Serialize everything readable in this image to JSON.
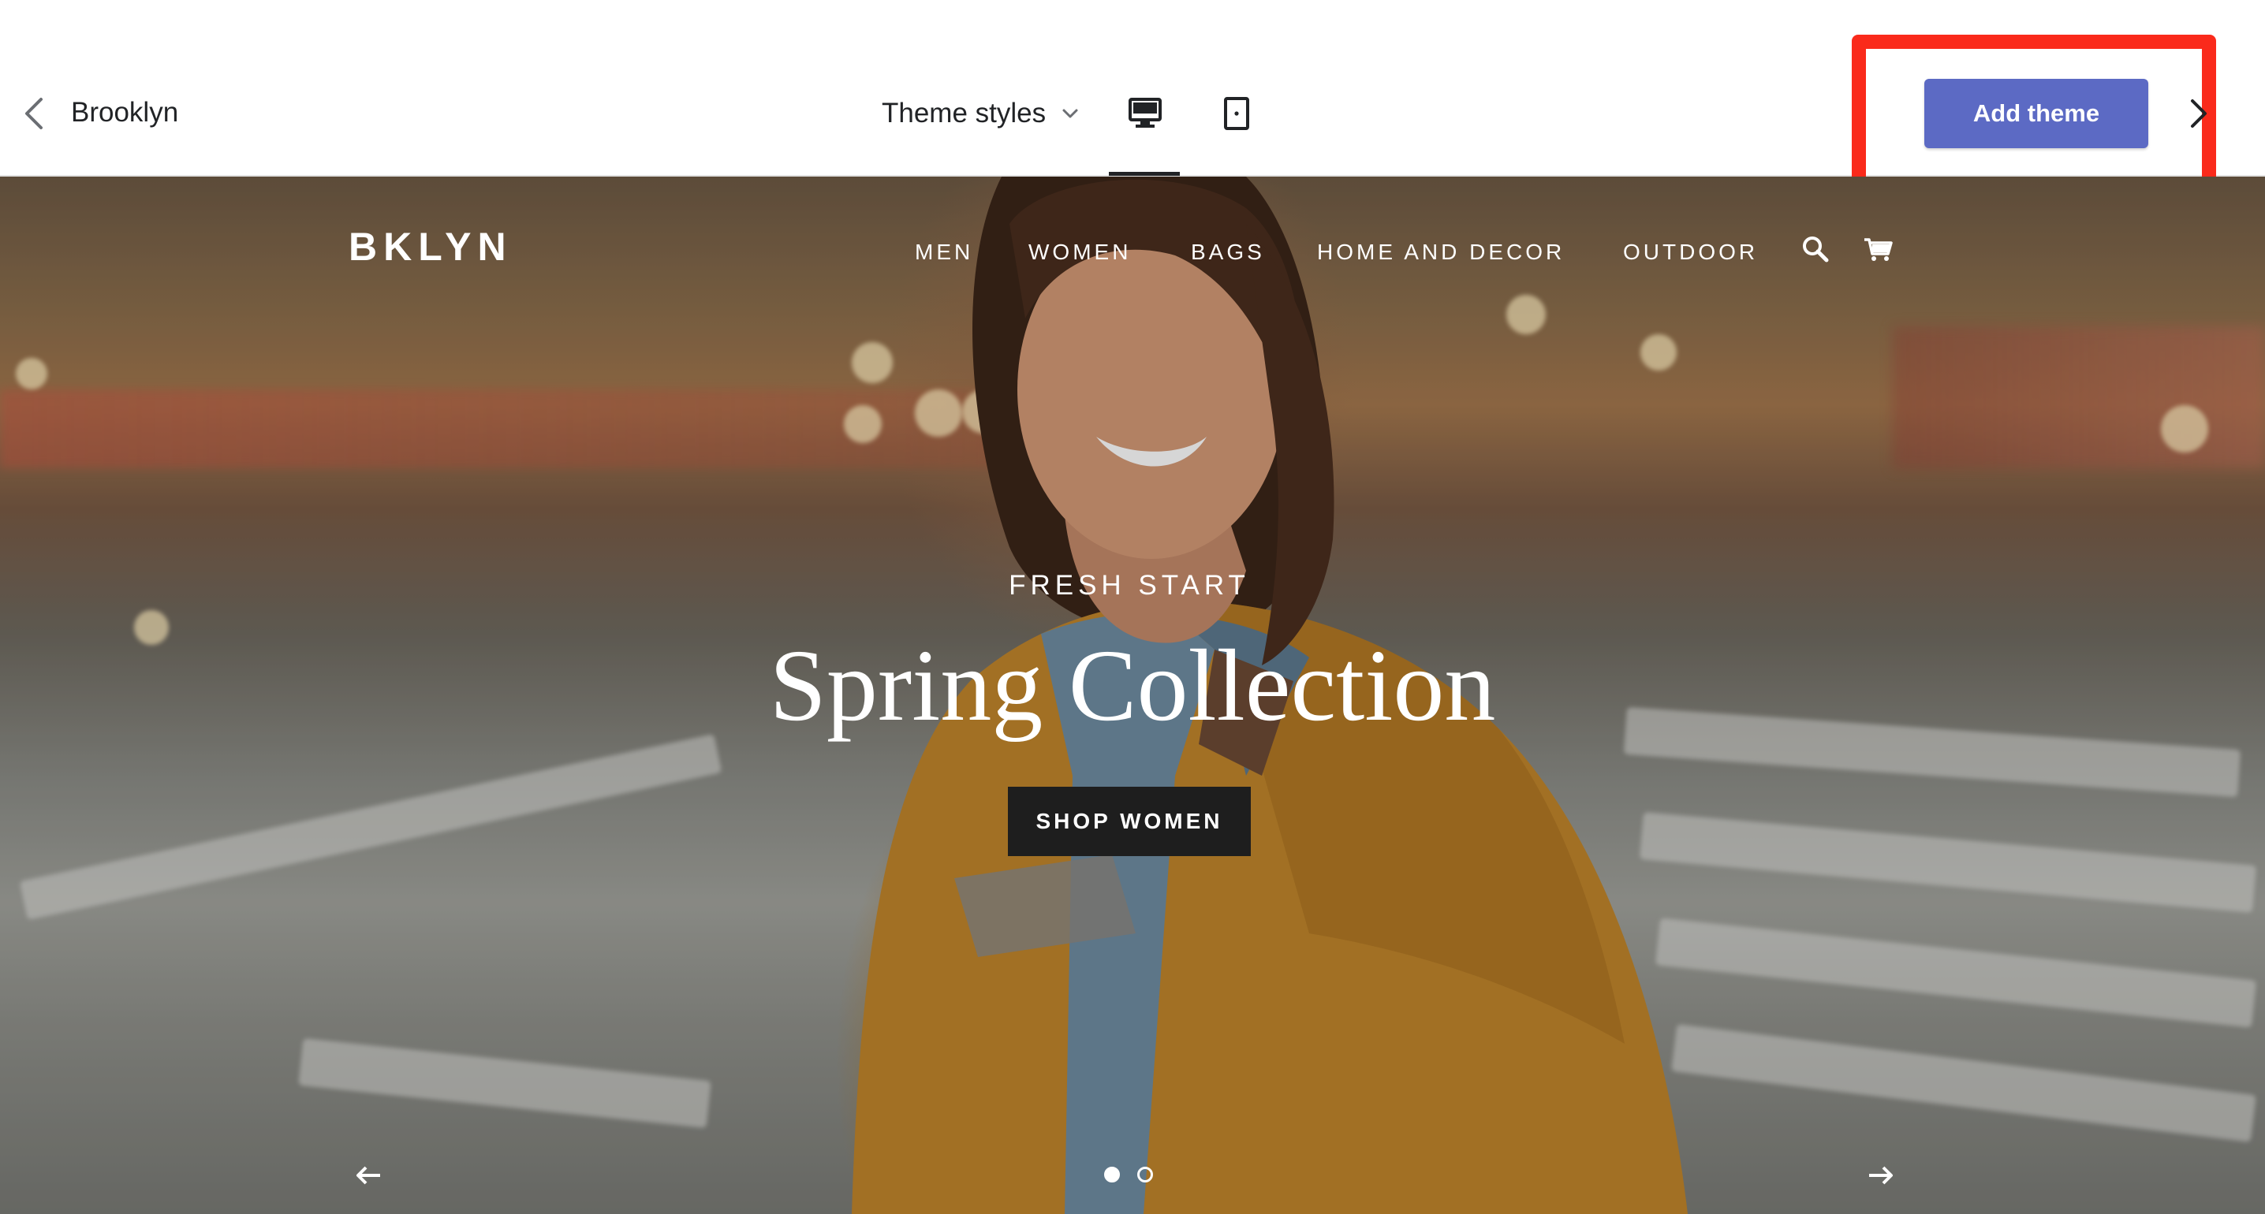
{
  "editor": {
    "theme_name": "Brooklyn",
    "theme_styles_label": "Theme styles",
    "add_theme_label": "Add theme",
    "accent_color": "#5c6ac4",
    "highlight_color": "#fa2a1b",
    "icons": {
      "back": "chevron-left-icon",
      "styles_dropdown": "chevron-down-icon",
      "desktop": "desktop-icon",
      "tablet": "tablet-icon",
      "next": "chevron-right-icon"
    },
    "active_device": "desktop"
  },
  "store": {
    "logo": "BKLYN",
    "nav": [
      "MEN",
      "WOMEN",
      "BAGS",
      "HOME AND DECOR",
      "OUTDOOR"
    ],
    "icons": {
      "search": "search-icon",
      "cart": "cart-icon"
    },
    "hero": {
      "kicker": "FRESH START",
      "title": "Spring Collection",
      "button_label": "SHOP WOMEN"
    },
    "slideshow": {
      "prev_icon": "arrow-left-icon",
      "next_icon": "arrow-right-icon",
      "slide_count": 2,
      "active_slide": 1
    }
  }
}
